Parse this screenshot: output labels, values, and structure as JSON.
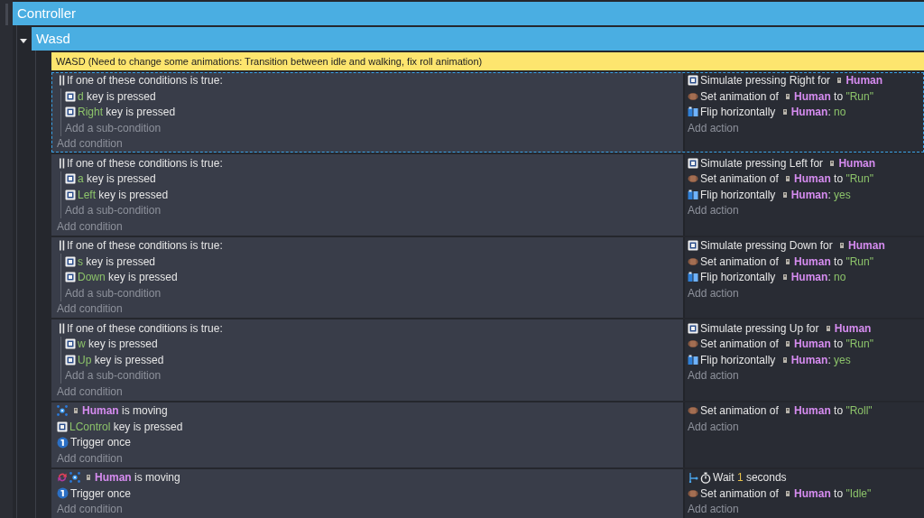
{
  "groups": [
    {
      "title": "Controller"
    },
    {
      "title": "Wasd",
      "expanded": true
    }
  ],
  "comment": "WASD (Need to change some animations: Transition between idle and walking, fix roll animation)",
  "events": [
    {
      "selected": true,
      "conditions": [
        {
          "kind": "or",
          "parts": [
            {
              "text": "If one of these conditions is true:",
              "kind": "plain"
            }
          ],
          "children": [
            {
              "kind": "key",
              "parts": [
                {
                  "text": "d",
                  "kind": "param"
                },
                {
                  "text": " key is pressed",
                  "kind": "plain"
                }
              ]
            },
            {
              "kind": "key",
              "parts": [
                {
                  "text": "Right",
                  "kind": "param"
                },
                {
                  "text": " key is pressed",
                  "kind": "plain"
                }
              ]
            }
          ],
          "add": "Add a sub-condition"
        }
      ],
      "add_condition": "Add condition",
      "actions": [
        {
          "kind": "key",
          "parts": [
            {
              "text": "Simulate pressing Right for ",
              "kind": "plain"
            },
            {
              "text": "Human",
              "kind": "object"
            }
          ]
        },
        {
          "kind": "animation",
          "parts": [
            {
              "text": "Set animation of ",
              "kind": "plain"
            },
            {
              "text": "Human",
              "kind": "object"
            },
            {
              "text": " to ",
              "kind": "plain"
            },
            {
              "text": "\"Run\"",
              "kind": "param"
            }
          ]
        },
        {
          "kind": "flip",
          "parts": [
            {
              "text": "Flip horizontally ",
              "kind": "plain"
            },
            {
              "text": "Human",
              "kind": "object"
            },
            {
              "text": ": ",
              "kind": "plain"
            },
            {
              "text": "no",
              "kind": "param"
            }
          ]
        }
      ],
      "add_action": "Add action"
    },
    {
      "selected": false,
      "conditions": [
        {
          "kind": "or",
          "parts": [
            {
              "text": "If one of these conditions is true:",
              "kind": "plain"
            }
          ],
          "children": [
            {
              "kind": "key",
              "parts": [
                {
                  "text": "a",
                  "kind": "param"
                },
                {
                  "text": " key is pressed",
                  "kind": "plain"
                }
              ]
            },
            {
              "kind": "key",
              "parts": [
                {
                  "text": "Left",
                  "kind": "param"
                },
                {
                  "text": " key is pressed",
                  "kind": "plain"
                }
              ]
            }
          ],
          "add": "Add a sub-condition"
        }
      ],
      "add_condition": "Add condition",
      "actions": [
        {
          "kind": "key",
          "parts": [
            {
              "text": "Simulate pressing Left for ",
              "kind": "plain"
            },
            {
              "text": "Human",
              "kind": "object"
            }
          ]
        },
        {
          "kind": "animation",
          "parts": [
            {
              "text": "Set animation of ",
              "kind": "plain"
            },
            {
              "text": "Human",
              "kind": "object"
            },
            {
              "text": " to ",
              "kind": "plain"
            },
            {
              "text": "\"Run\"",
              "kind": "param"
            }
          ]
        },
        {
          "kind": "flip",
          "parts": [
            {
              "text": "Flip horizontally ",
              "kind": "plain"
            },
            {
              "text": "Human",
              "kind": "object"
            },
            {
              "text": ": ",
              "kind": "plain"
            },
            {
              "text": "yes",
              "kind": "param"
            }
          ]
        }
      ],
      "add_action": "Add action"
    },
    {
      "selected": false,
      "conditions": [
        {
          "kind": "or",
          "parts": [
            {
              "text": "If one of these conditions is true:",
              "kind": "plain"
            }
          ],
          "children": [
            {
              "kind": "key",
              "parts": [
                {
                  "text": "s",
                  "kind": "param"
                },
                {
                  "text": " key is pressed",
                  "kind": "plain"
                }
              ]
            },
            {
              "kind": "key",
              "parts": [
                {
                  "text": "Down",
                  "kind": "param"
                },
                {
                  "text": " key is pressed",
                  "kind": "plain"
                }
              ]
            }
          ],
          "add": "Add a sub-condition"
        }
      ],
      "add_condition": "Add condition",
      "actions": [
        {
          "kind": "key",
          "parts": [
            {
              "text": "Simulate pressing Down for ",
              "kind": "plain"
            },
            {
              "text": "Human",
              "kind": "object"
            }
          ]
        },
        {
          "kind": "animation",
          "parts": [
            {
              "text": "Set animation of ",
              "kind": "plain"
            },
            {
              "text": "Human",
              "kind": "object"
            },
            {
              "text": " to ",
              "kind": "plain"
            },
            {
              "text": "\"Run\"",
              "kind": "param"
            }
          ]
        },
        {
          "kind": "flip",
          "parts": [
            {
              "text": "Flip horizontally ",
              "kind": "plain"
            },
            {
              "text": "Human",
              "kind": "object"
            },
            {
              "text": ": ",
              "kind": "plain"
            },
            {
              "text": "no",
              "kind": "param"
            }
          ]
        }
      ],
      "add_action": "Add action"
    },
    {
      "selected": false,
      "conditions": [
        {
          "kind": "or",
          "parts": [
            {
              "text": "If one of these conditions is true:",
              "kind": "plain"
            }
          ],
          "children": [
            {
              "kind": "key",
              "parts": [
                {
                  "text": "w",
                  "kind": "param"
                },
                {
                  "text": " key is pressed",
                  "kind": "plain"
                }
              ]
            },
            {
              "kind": "key",
              "parts": [
                {
                  "text": "Up",
                  "kind": "param"
                },
                {
                  "text": " key is pressed",
                  "kind": "plain"
                }
              ]
            }
          ],
          "add": "Add a sub-condition"
        }
      ],
      "add_condition": "Add condition",
      "actions": [
        {
          "kind": "key",
          "parts": [
            {
              "text": "Simulate pressing Up for ",
              "kind": "plain"
            },
            {
              "text": "Human",
              "kind": "object"
            }
          ]
        },
        {
          "kind": "animation",
          "parts": [
            {
              "text": "Set animation of ",
              "kind": "plain"
            },
            {
              "text": "Human",
              "kind": "object"
            },
            {
              "text": " to ",
              "kind": "plain"
            },
            {
              "text": "\"Run\"",
              "kind": "param"
            }
          ]
        },
        {
          "kind": "flip",
          "parts": [
            {
              "text": "Flip horizontally ",
              "kind": "plain"
            },
            {
              "text": "Human",
              "kind": "object"
            },
            {
              "text": ": ",
              "kind": "plain"
            },
            {
              "text": "yes",
              "kind": "param"
            }
          ]
        }
      ],
      "add_action": "Add action"
    },
    {
      "selected": false,
      "conditions": [
        {
          "kind": "moving",
          "parts": [
            {
              "text": "Human",
              "kind": "object"
            },
            {
              "text": " is moving",
              "kind": "plain"
            }
          ]
        },
        {
          "kind": "key",
          "parts": [
            {
              "text": "LControl",
              "kind": "param"
            },
            {
              "text": " key is pressed",
              "kind": "plain"
            }
          ]
        },
        {
          "kind": "trigger",
          "parts": [
            {
              "text": "Trigger once",
              "kind": "plain"
            }
          ]
        }
      ],
      "add_condition": "Add condition",
      "actions": [
        {
          "kind": "animation",
          "parts": [
            {
              "text": "Set animation of ",
              "kind": "plain"
            },
            {
              "text": "Human",
              "kind": "object"
            },
            {
              "text": " to ",
              "kind": "plain"
            },
            {
              "text": "\"Roll\"",
              "kind": "param"
            }
          ]
        }
      ],
      "add_action": "Add action"
    },
    {
      "selected": false,
      "conditions": [
        {
          "kind": "async-moving",
          "parts": [
            {
              "text": "Human",
              "kind": "object"
            },
            {
              "text": " is moving",
              "kind": "plain"
            }
          ]
        },
        {
          "kind": "trigger",
          "parts": [
            {
              "text": "Trigger once",
              "kind": "plain"
            }
          ]
        }
      ],
      "add_condition": "Add condition",
      "actions": [
        {
          "kind": "async-wait",
          "parts": [
            {
              "text": "Wait ",
              "kind": "plain"
            },
            {
              "text": "1",
              "kind": "number"
            },
            {
              "text": " seconds",
              "kind": "plain"
            }
          ]
        },
        {
          "kind": "animation",
          "parts": [
            {
              "text": "Set animation of ",
              "kind": "plain"
            },
            {
              "text": "Human",
              "kind": "object"
            },
            {
              "text": " to ",
              "kind": "plain"
            },
            {
              "text": "\"Idle\"",
              "kind": "param"
            }
          ]
        }
      ],
      "add_action": "Add action"
    }
  ]
}
